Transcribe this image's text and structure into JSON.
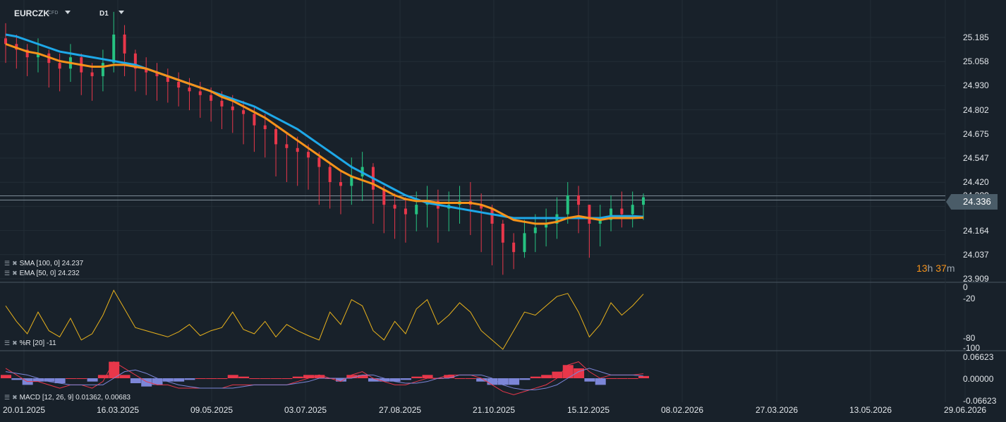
{
  "header": {
    "symbol": "EURCZK",
    "type": "CFD",
    "timeframe": "D1"
  },
  "price_axis": {
    "ticks": [
      "25.185",
      "25.058",
      "24.930",
      "24.802",
      "24.675",
      "24.547",
      "24.420",
      "24.292",
      "24.164",
      "24.037",
      "23.909"
    ],
    "current_price": "24.336",
    "hidden_label": "24.3??"
  },
  "countdown": {
    "hours": "13",
    "h": "h",
    "minutes": "37",
    "m": "m"
  },
  "indicators": {
    "sma": "SMA [100,  0] 24.237",
    "ema": "EMA [50,  0] 24.232",
    "wr": "%R [20]  -11",
    "macd": "MACD [12, 26, 9] 0.01362,  0.00683"
  },
  "wr_axis": [
    "0",
    "-20",
    "-80",
    "-100"
  ],
  "macd_axis": [
    "0.06623",
    "0.00000",
    "-0.06623"
  ],
  "date_axis": [
    "20.01.2025",
    "16.03.2025",
    "09.05.2025",
    "03.07.2025",
    "27.08.2025",
    "21.10.2025",
    "15.12.2025",
    "08.02.2026",
    "27.03.2026",
    "13.05.2026",
    "29.06.2026"
  ],
  "colors": {
    "up": "#26c281",
    "down": "#e8374a",
    "sma": "#1ea8e8",
    "ema": "#f7931a",
    "wr": "#e8b21c",
    "macd_hist_pos": "#e8374a",
    "macd_hist_neg": "#7c86d8",
    "macd_line": "#e8374a",
    "signal_line": "#7c86d8",
    "countdown": "#f7931a"
  },
  "chart_data": {
    "type": "candlestick",
    "ylim": [
      23.909,
      25.185
    ],
    "close": [
      25.15,
      25.12,
      25.08,
      25.1,
      25.05,
      25.02,
      25.08,
      25.0,
      24.98,
      25.05,
      25.2,
      25.1,
      25.02,
      25.0,
      24.98,
      24.95,
      24.92,
      24.9,
      24.88,
      24.85,
      24.82,
      24.8,
      24.78,
      24.72,
      24.7,
      24.62,
      24.6,
      24.58,
      24.55,
      24.5,
      24.42,
      24.4,
      24.45,
      24.5,
      24.38,
      24.3,
      24.28,
      24.25,
      24.3,
      24.32,
      24.28,
      24.3,
      24.32,
      24.3,
      24.28,
      24.2,
      24.1,
      24.05,
      24.15,
      24.18,
      24.2,
      24.25,
      24.35,
      24.3,
      24.2,
      24.22,
      24.28,
      24.25,
      24.3,
      24.34
    ],
    "high": [
      25.26,
      25.2,
      25.15,
      25.18,
      25.12,
      25.1,
      25.15,
      25.1,
      25.05,
      25.12,
      25.32,
      25.25,
      25.12,
      25.08,
      25.05,
      25.02,
      25.0,
      24.97,
      24.95,
      24.92,
      24.9,
      24.88,
      24.85,
      24.82,
      24.78,
      24.72,
      24.68,
      24.66,
      24.62,
      24.58,
      24.52,
      24.48,
      24.55,
      24.58,
      24.52,
      24.4,
      24.36,
      24.34,
      24.37,
      24.4,
      24.38,
      24.37,
      24.4,
      24.42,
      24.36,
      24.3,
      24.22,
      24.15,
      24.22,
      24.25,
      24.28,
      24.34,
      24.42,
      24.4,
      24.3,
      24.3,
      24.35,
      24.37,
      24.37,
      24.36
    ],
    "low": [
      25.05,
      25.02,
      24.98,
      25.0,
      24.92,
      24.9,
      24.95,
      24.88,
      24.85,
      24.9,
      25.0,
      24.98,
      24.9,
      24.88,
      24.85,
      24.84,
      24.82,
      24.8,
      24.76,
      24.74,
      24.7,
      24.68,
      24.62,
      24.58,
      24.55,
      24.45,
      24.42,
      24.4,
      24.38,
      24.3,
      24.28,
      24.25,
      24.3,
      24.32,
      24.2,
      24.15,
      24.12,
      24.1,
      24.16,
      24.18,
      24.1,
      24.16,
      24.2,
      24.14,
      24.05,
      23.98,
      23.93,
      23.96,
      24.02,
      24.05,
      24.08,
      24.12,
      24.2,
      24.15,
      24.02,
      24.08,
      24.16,
      24.18,
      24.18,
      24.22
    ],
    "sma": [
      25.2,
      25.19,
      25.17,
      25.15,
      25.13,
      25.11,
      25.1,
      25.09,
      25.08,
      25.07,
      25.06,
      25.05,
      25.04,
      25.02,
      25.0,
      24.98,
      24.96,
      24.94,
      24.92,
      24.9,
      24.88,
      24.86,
      24.84,
      24.82,
      24.79,
      24.76,
      24.73,
      24.7,
      24.66,
      24.62,
      24.58,
      24.54,
      24.5,
      24.47,
      24.44,
      24.41,
      24.38,
      24.35,
      24.33,
      24.31,
      24.3,
      24.29,
      24.28,
      24.27,
      24.26,
      24.25,
      24.24,
      24.23,
      24.23,
      24.23,
      24.23,
      24.23,
      24.23,
      24.23,
      24.23,
      24.23,
      24.24,
      24.24,
      24.24,
      24.237
    ],
    "ema": [
      25.15,
      25.13,
      25.11,
      25.1,
      25.08,
      25.06,
      25.05,
      25.04,
      25.03,
      25.03,
      25.04,
      25.04,
      25.03,
      25.02,
      25.0,
      24.98,
      24.96,
      24.94,
      24.92,
      24.9,
      24.87,
      24.85,
      24.82,
      24.79,
      24.76,
      24.72,
      24.68,
      24.64,
      24.6,
      24.56,
      24.52,
      24.48,
      24.45,
      24.43,
      24.41,
      24.38,
      24.35,
      24.33,
      24.32,
      24.32,
      24.31,
      24.31,
      24.31,
      24.31,
      24.3,
      24.28,
      24.25,
      24.22,
      24.21,
      24.2,
      24.2,
      24.21,
      24.23,
      24.24,
      24.23,
      24.22,
      24.23,
      24.23,
      24.23,
      24.232
    ],
    "wr": [
      -30,
      -55,
      -75,
      -40,
      -70,
      -80,
      -50,
      -85,
      -75,
      -45,
      -5,
      -35,
      -65,
      -70,
      -75,
      -80,
      -72,
      -60,
      -78,
      -70,
      -65,
      -40,
      -68,
      -75,
      -55,
      -80,
      -60,
      -70,
      -78,
      -85,
      -40,
      -60,
      -20,
      -30,
      -70,
      -85,
      -55,
      -75,
      -35,
      -20,
      -60,
      -45,
      -25,
      -40,
      -70,
      -85,
      -100,
      -70,
      -40,
      -45,
      -30,
      -15,
      -10,
      -40,
      -80,
      -60,
      -25,
      -45,
      -30,
      -11
    ],
    "macd": [
      0.03,
      0.01,
      -0.01,
      -0.01,
      -0.02,
      -0.03,
      -0.02,
      -0.02,
      -0.03,
      -0.01,
      0.05,
      0.03,
      0.01,
      -0.01,
      -0.02,
      -0.02,
      -0.03,
      -0.03,
      -0.03,
      -0.03,
      -0.03,
      -0.02,
      -0.02,
      -0.02,
      -0.02,
      -0.02,
      -0.02,
      -0.01,
      0.0,
      0.01,
      0.0,
      -0.01,
      0.01,
      0.02,
      0.0,
      -0.01,
      -0.02,
      -0.02,
      -0.01,
      0.0,
      0.0,
      0.01,
      0.01,
      0.01,
      0.0,
      -0.02,
      -0.04,
      -0.05,
      -0.04,
      -0.03,
      -0.02,
      0.0,
      0.04,
      0.05,
      0.02,
      0.0,
      0.01,
      0.01,
      0.01,
      0.0136
    ],
    "signal": [
      0.02,
      0.015,
      0.01,
      0.0,
      -0.01,
      -0.015,
      -0.02,
      -0.02,
      -0.02,
      -0.02,
      0.0,
      0.02,
      0.025,
      0.015,
      0.0,
      -0.01,
      -0.02,
      -0.025,
      -0.03,
      -0.03,
      -0.03,
      -0.03,
      -0.025,
      -0.02,
      -0.02,
      -0.02,
      -0.02,
      -0.015,
      -0.01,
      0.0,
      0.0,
      0.0,
      0.0,
      0.01,
      0.01,
      0.0,
      -0.01,
      -0.015,
      -0.015,
      -0.01,
      0.0,
      0.0,
      0.01,
      0.01,
      0.01,
      0.0,
      -0.02,
      -0.03,
      -0.035,
      -0.035,
      -0.03,
      -0.02,
      0.0,
      0.02,
      0.03,
      0.02,
      0.01,
      0.01,
      0.01,
      0.0068
    ]
  }
}
